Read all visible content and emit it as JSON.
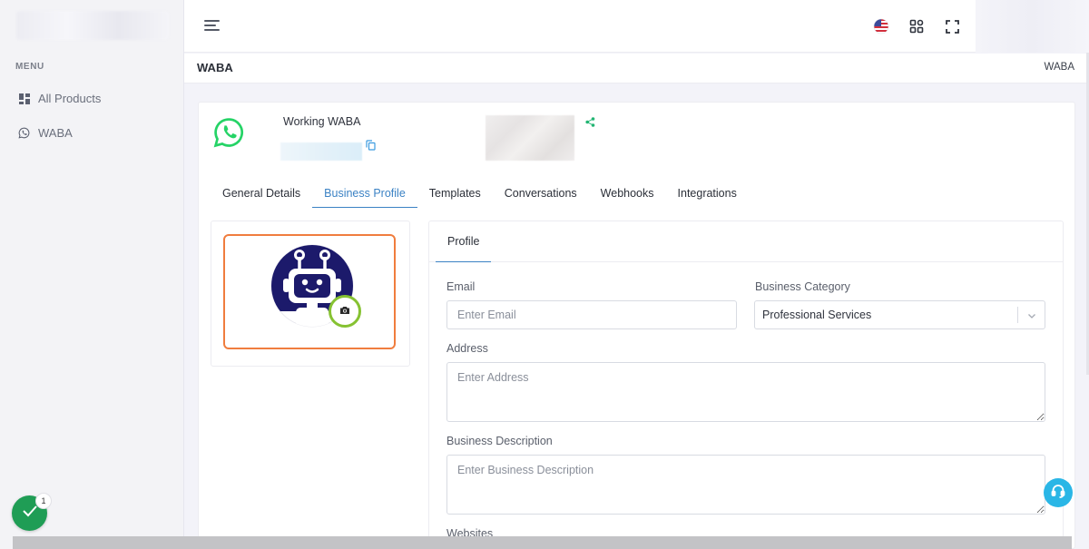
{
  "sidebar": {
    "menu_title": "MENU",
    "items": [
      {
        "label": "All Products",
        "icon": "grid-icon"
      },
      {
        "label": "WABA",
        "icon": "whatsapp-icon"
      }
    ]
  },
  "topbar": {
    "icons": [
      "us-flag-icon",
      "apps-grid-icon",
      "fullscreen-icon"
    ]
  },
  "page": {
    "title": "WABA",
    "breadcrumb": "WABA"
  },
  "account": {
    "name": "Working WABA"
  },
  "tabs": [
    {
      "label": "General Details",
      "active": false
    },
    {
      "label": "Business Profile",
      "active": true
    },
    {
      "label": "Templates",
      "active": false
    },
    {
      "label": "Conversations",
      "active": false
    },
    {
      "label": "Webhooks",
      "active": false
    },
    {
      "label": "Integrations",
      "active": false
    }
  ],
  "profile": {
    "tab_label": "Profile",
    "email": {
      "label": "Email",
      "placeholder": "Enter Email",
      "value": ""
    },
    "category": {
      "label": "Business Category",
      "value": "Professional Services"
    },
    "address": {
      "label": "Address",
      "placeholder": "Enter Address",
      "value": ""
    },
    "description": {
      "label": "Business Description",
      "placeholder": "Enter Business Description",
      "value": ""
    },
    "websites": {
      "label": "Websites"
    }
  },
  "notifications": {
    "count": "1"
  },
  "colors": {
    "accent": "#3b82c4",
    "whatsapp_green": "#25d366",
    "avatar_border": "#f07d3e",
    "camera_ring": "#86c232",
    "support": "#2ab6e6",
    "status_fab": "#1f9d55"
  }
}
